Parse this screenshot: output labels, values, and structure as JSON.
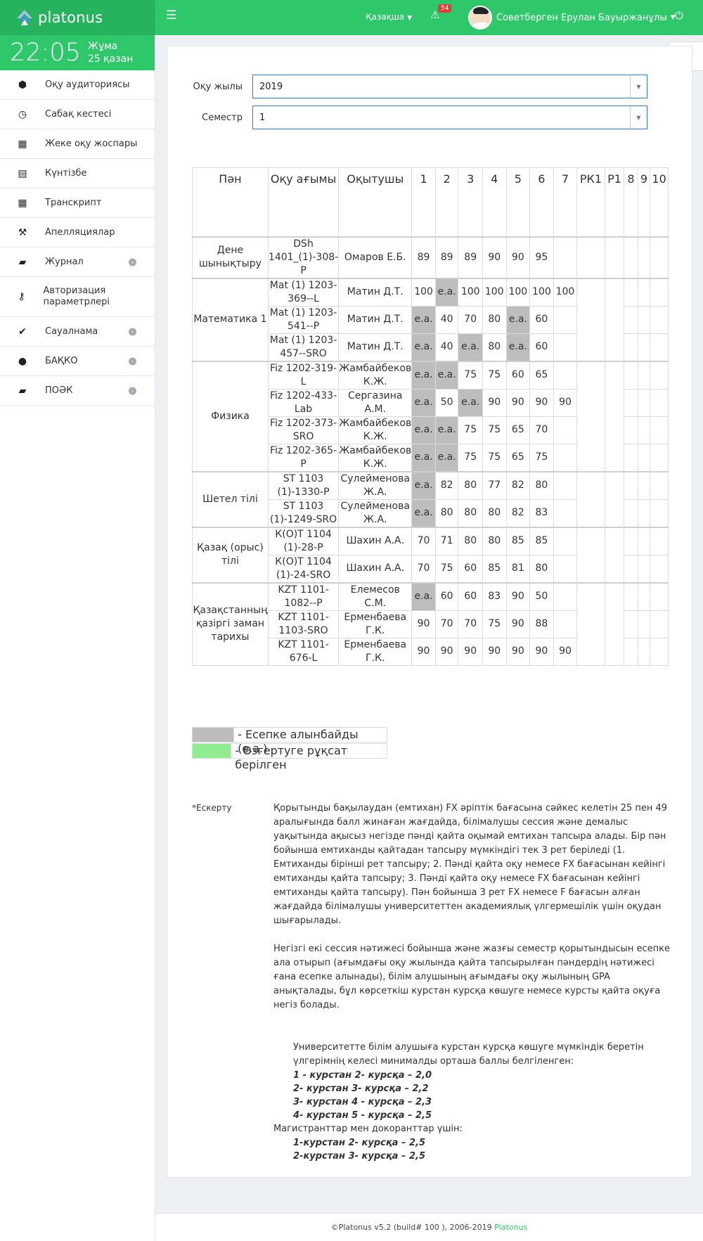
{
  "brand": {
    "name": "platonus"
  },
  "topbar": {
    "language": "Қазақша",
    "alert_count": "54",
    "user_name": "Советберген Ерулан Бауыржанұлы"
  },
  "clock": {
    "time": "22:05",
    "day": "Жұма",
    "date": "25 қазан"
  },
  "sidebar": {
    "items": [
      {
        "label": "Оқу аудиториясы",
        "icon": "cubes-icon",
        "arrow": false
      },
      {
        "label": "Сабақ кестесі",
        "icon": "clock-icon",
        "arrow": false
      },
      {
        "label": "Жеке оқу жоспары",
        "icon": "grid-icon",
        "arrow": false
      },
      {
        "label": "Күнтізбе",
        "icon": "calendar-icon",
        "arrow": false
      },
      {
        "label": "Транскрипт",
        "icon": "table-icon",
        "arrow": false
      },
      {
        "label": "Апелляциялар",
        "icon": "gavel-icon",
        "arrow": false
      },
      {
        "label": "Журнал",
        "icon": "book-icon",
        "arrow": true
      },
      {
        "label": "Авторизация параметрлері",
        "icon": "key-icon",
        "arrow": false
      },
      {
        "label": "Сауалнама",
        "icon": "check-circle-icon",
        "arrow": true
      },
      {
        "label": "БАҚКО",
        "icon": "user-icon",
        "arrow": true
      },
      {
        "label": "ПОӘК",
        "icon": "book-icon",
        "arrow": true
      }
    ]
  },
  "filters": {
    "year_label": "Оқу жылы",
    "year_value": "2019",
    "semester_label": "Семестр",
    "semester_value": "1"
  },
  "table": {
    "headers": [
      "Пән",
      "Оқу ағымы",
      "Оқытушы",
      "1",
      "2",
      "3",
      "4",
      "5",
      "6",
      "7",
      "РК1",
      "Р1",
      "8",
      "9",
      "10"
    ],
    "groups": [
      {
        "subject": "Дене шынықтыру",
        "rows": [
          {
            "stream": "DSh 1401_(1)-308-P",
            "teacher": "Омаров Е.Б.",
            "grades": [
              "89",
              "89",
              "89",
              "90",
              "90",
              "95",
              ""
            ]
          }
        ]
      },
      {
        "subject": "Математика 1",
        "rows": [
          {
            "stream": "Mat (1) 1203-369--L",
            "teacher": "Матин Д.Т.",
            "grades": [
              "100",
              "е.а.",
              "100",
              "100",
              "100",
              "100",
              "100"
            ]
          },
          {
            "stream": "Mat (1) 1203-541--P",
            "teacher": "Матин Д.Т.",
            "grades": [
              "е.а.",
              "40",
              "70",
              "80",
              "е.а.",
              "60",
              ""
            ]
          },
          {
            "stream": "Mat (1) 1203-457--SRO",
            "teacher": "Матин Д.Т.",
            "grades": [
              "е.а.",
              "40",
              "е.а.",
              "80",
              "е.а.",
              "60",
              ""
            ]
          }
        ]
      },
      {
        "subject": "Физика",
        "rows": [
          {
            "stream": "Fiz 1202-319-L",
            "teacher": "Жамбайбеков К.Ж.",
            "grades": [
              "е.а.",
              "е.а.",
              "75",
              "75",
              "60",
              "65",
              ""
            ]
          },
          {
            "stream": "Fiz 1202-433-Lab",
            "teacher": "Сергазина А.М.",
            "grades": [
              "е.а.",
              "50",
              "е.а.",
              "90",
              "90",
              "90",
              "90"
            ]
          },
          {
            "stream": "Fiz 1202-373-SRO",
            "teacher": "Жамбайбеков К.Ж.",
            "grades": [
              "е.а.",
              "е.а.",
              "75",
              "75",
              "65",
              "70",
              ""
            ]
          },
          {
            "stream": "Fiz 1202-365-P",
            "teacher": "Жамбайбеков К.Ж.",
            "grades": [
              "е.а.",
              "е.а.",
              "75",
              "75",
              "65",
              "75",
              ""
            ]
          }
        ]
      },
      {
        "subject": "Шетел тілі",
        "rows": [
          {
            "stream": "ST 1103 (1)-1330-P",
            "teacher": "Сулейменова Ж.А.",
            "grades": [
              "е.а.",
              "82",
              "80",
              "77",
              "82",
              "80",
              ""
            ]
          },
          {
            "stream": "ST 1103 (1)-1249-SRO",
            "teacher": "Сулейменова Ж.А.",
            "grades": [
              "е.а.",
              "80",
              "80",
              "80",
              "82",
              "83",
              ""
            ]
          }
        ]
      },
      {
        "subject": "Қазақ (орыс) тілі",
        "rows": [
          {
            "stream": "К(О)Т 1104 (1)-28-P",
            "teacher": "Шахин А.А.",
            "grades": [
              "70",
              "71",
              "80",
              "80",
              "85",
              "85",
              ""
            ]
          },
          {
            "stream": "К(О)Т 1104 (1)-24-SRO",
            "teacher": "Шахин А.А.",
            "grades": [
              "70",
              "75",
              "60",
              "85",
              "81",
              "80",
              ""
            ]
          }
        ]
      },
      {
        "subject": "Қазақстанның қазіргі заман тарихы",
        "rows": [
          {
            "stream": "KZT 1101-1082--P",
            "teacher": "Елемесов С.М.",
            "grades": [
              "е.а.",
              "60",
              "60",
              "83",
              "90",
              "50",
              ""
            ]
          },
          {
            "stream": "KZT 1101-1103-SRO",
            "teacher": "Ерменбаева Г.К.",
            "grades": [
              "90",
              "70",
              "70",
              "75",
              "90",
              "88",
              ""
            ]
          },
          {
            "stream": "KZT 1101-676-L",
            "teacher": "Ерменбаева Г.К.",
            "grades": [
              "90",
              "90",
              "90",
              "90",
              "90",
              "90",
              "90"
            ]
          }
        ]
      }
    ]
  },
  "legend": [
    {
      "text": "- Есепке алынбайды (е.а.)",
      "color": "#bdbdbd"
    },
    {
      "text": "- Өзгертуге рұқсат берілген",
      "color": "#90ee90"
    }
  ],
  "note": {
    "label": "*Ескерту",
    "p1": "Қорытынды бақылаудан (емтихан) FX әріптік бағасына сәйкес келетін 25 пен 49 аралығында балл жинаған жағдайда, білімалушы сессия және демалыс уақытында ақысыз негізде пәнді қайта оқымай емтихан тапсыра алады. Бір пән бойынша емтиханды қайтадан тапсыру мүмкіндігі тек 3 рет беріледі (1. Емтиханды бірінші рет тапсыру; 2. Пәнді қайта оқу немесе FX бағасынан кейінгі емтиханды қайта тапсыру; 3. Пәнді қайта оқу немесе FX бағасынан кейінгі емтиханды қайта тапсыру). Пән бойынша 3 рет FX немесе F бағасын алған жағдайда білімалушы университеттен академиялық үлгермешілік үшін оқудан шығарылады.",
    "p2": "Негізгі екі сессия нәтижесі бойынша және жазғы семестр қорытындысын есепке ала отырып (ағымдағы оқу жылында қайта тапсырылған пәндердің нәтижесі ғана есепке алынады), білім алушының ағымдағы оқу жылының GPA анықталады, бұл көрсеткіш курстан курсқа көшуге немесе курсты қайта оқуға негіз болады.",
    "p3": "Университетте білім алушыға курстан курсқа көшуге мүмкіндік беретін үлгерімнің келесі минималды орташа баллы белгіленген:",
    "rules": [
      "1 - курстан 2- курсқа – 2,0",
      "2- курстан 3- курсқа  – 2,2",
      "3- курстан 4 - курсқа – 2,3",
      "4- курстан 5 - курсқа – 2,5"
    ],
    "masters_label": "Магистранттар мен докоранттар үшін:",
    "masters_rules": [
      "1-курстан 2- курсқа – 2,5",
      "2-курстан 3- курсқа – 2,5"
    ]
  },
  "footer": {
    "text": "©Platonus v5.2 (build# 100 ), 2006-2019 ",
    "link": "Platonus"
  }
}
